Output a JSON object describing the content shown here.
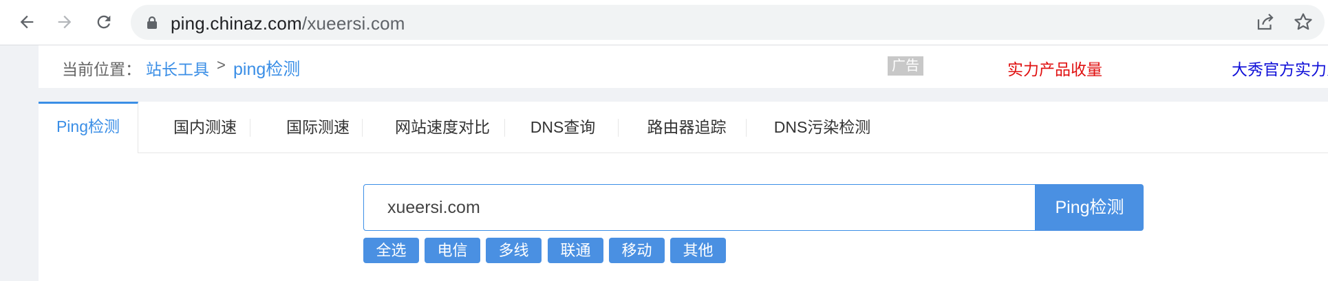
{
  "browser": {
    "url_host": "ping.chinaz.com",
    "url_path": "/xueersi.com"
  },
  "breadcrumb": {
    "prefix": "当前位置：",
    "items": [
      "站长工具",
      "ping检测"
    ],
    "separator": ">"
  },
  "ads": {
    "badge": "广告",
    "text1": "实力产品收量",
    "text2": "大秀官方实力入",
    "text1_color": "#e01010",
    "text2_color": "#0f0fd8"
  },
  "tabs": [
    {
      "label": "Ping检测",
      "active": true
    },
    {
      "label": "国内测速"
    },
    {
      "label": "国际测速"
    },
    {
      "label": "网站速度对比"
    },
    {
      "label": "DNS查询"
    },
    {
      "label": "路由器追踪"
    },
    {
      "label": "DNS污染检测"
    }
  ],
  "search": {
    "value": "xueersi.com",
    "button": "Ping检测"
  },
  "filters": [
    "全选",
    "电信",
    "多线",
    "联通",
    "移动",
    "其他"
  ],
  "colors": {
    "accent": "#3a8ee6",
    "button": "#4a90e2"
  }
}
